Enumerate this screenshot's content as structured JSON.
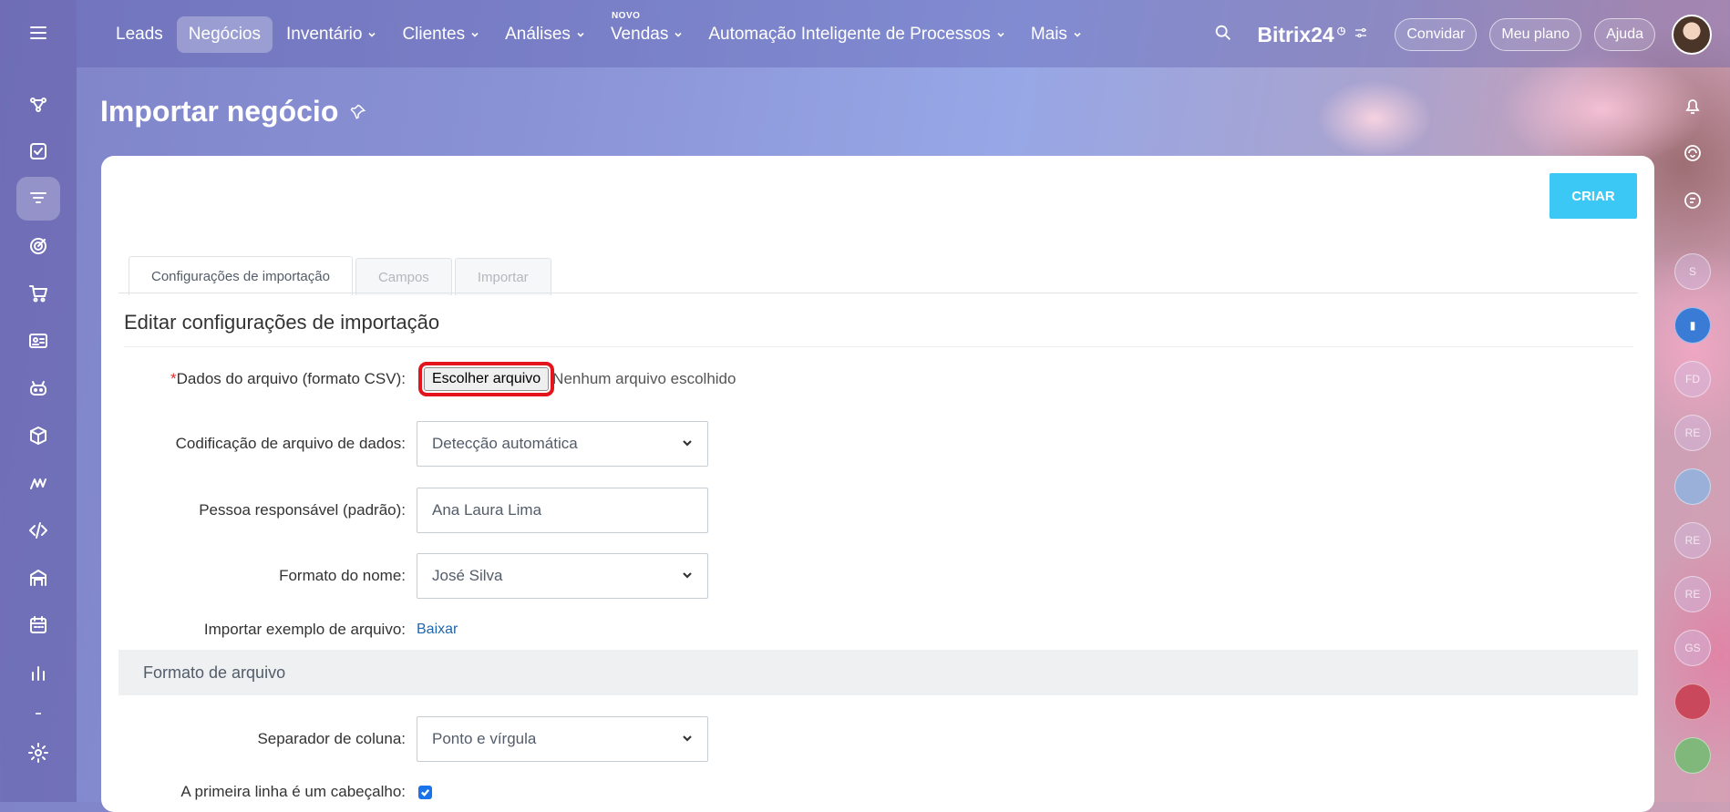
{
  "nav": {
    "items": [
      {
        "label": "Leads",
        "dropdown": false
      },
      {
        "label": "Negócios",
        "dropdown": false,
        "active": true
      },
      {
        "label": "Inventário",
        "dropdown": true
      },
      {
        "label": "Clientes",
        "dropdown": true
      },
      {
        "label": "Análises",
        "dropdown": true
      },
      {
        "label": "Vendas",
        "dropdown": true,
        "badge": "NOVO"
      },
      {
        "label": "Automação Inteligente de Processos",
        "dropdown": true
      },
      {
        "label": "Mais",
        "dropdown": true
      }
    ]
  },
  "header": {
    "brand": "Bitrix",
    "brand_num": "24",
    "invite": "Convidar",
    "plan": "Meu plano",
    "help": "Ajuda"
  },
  "page": {
    "title": "Importar negócio",
    "create_button": "CRIAR"
  },
  "tabs": [
    {
      "label": "Configurações de importação",
      "active": true
    },
    {
      "label": "Campos",
      "active": false
    },
    {
      "label": "Importar",
      "active": false
    }
  ],
  "section": {
    "title": "Editar configurações de importação"
  },
  "form": {
    "required_mark": "*",
    "file_label": "Dados do arquivo (formato CSV):",
    "file_button": "Escolher arquivo",
    "file_none": "Nenhum arquivo escolhido",
    "encoding_label": "Codificação de arquivo de dados:",
    "encoding_value": "Detecção automática",
    "responsible_label": "Pessoa responsável (padrão):",
    "responsible_value": "Ana Laura Lima",
    "name_format_label": "Formato do nome:",
    "name_format_value": "José Silva",
    "example_label": "Importar exemplo de arquivo:",
    "example_link": "Baixar"
  },
  "file_format": {
    "title": "Formato de arquivo",
    "separator_label": "Separador de coluna:",
    "separator_value": "Ponto e vírgula",
    "header_row_label": "A primeira linha é um cabeçalho:",
    "header_row_checked": true
  },
  "right_rail": {
    "avatars": [
      "S",
      "",
      "FD",
      "RE",
      "",
      "RE",
      "RE",
      "GS"
    ]
  },
  "colors": {
    "accent": "#3bc8f5",
    "highlight": "#e3141b",
    "link": "#2067b0"
  }
}
